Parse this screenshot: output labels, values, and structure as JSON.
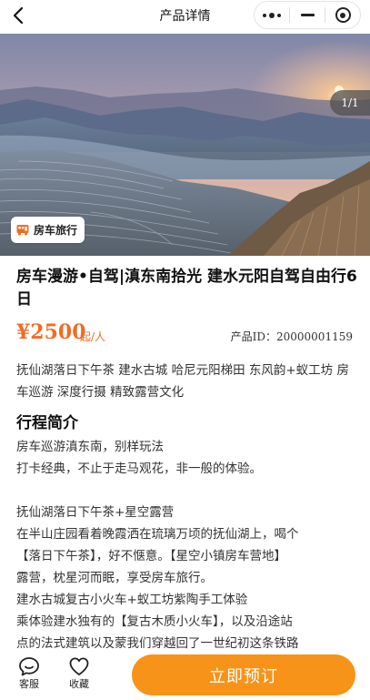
{
  "navbar": {
    "title": "产品详情",
    "back_icon": "chevron-left-icon",
    "capsule_icons": [
      "more-dots-icon",
      "minimize-icon",
      "target-icon"
    ]
  },
  "hero": {
    "counter": "1/1",
    "tag_label": "房车旅行",
    "tag_icon": "rv-travel-icon"
  },
  "product": {
    "title": "房车漫游•自驾|滇东南拾光 建水元阳自驾自由行6日",
    "price": "¥2500",
    "price_suffix": "起/人",
    "product_id": "产品ID：20000001159",
    "features": "抚仙湖落日下午茶 建水古城 哈尼元阳梯田 东风韵+蚁工坊 房车巡游 深度行摄 精致露营文化"
  },
  "itinerary": {
    "section_title": "行程简介",
    "lines": [
      "房车巡游滇东南，别样玩法",
      "打卡经典，不止于走马观花，非一般的体验。",
      "",
      "抚仙湖落日下午茶+星空露营",
      "在半山庄园看着晚霞洒在琉璃万顷的抚仙湖上，喝个",
      "【落日下午茶】，好不惬意。【星空小镇房车营地】",
      "露营，枕星河而眠，享受房车旅行。",
      "建水古城复古小火车+蚁工坊紫陶手工体验",
      "乘体验建水独有的【复古木质小火车】，以及沿途站",
      "点的法式建筑以及蒙我们穿越回了一世纪初这条铁路"
    ]
  },
  "bottom_bar": {
    "service_label": "客服",
    "favorite_label": "收藏",
    "book_label": "立即预订"
  },
  "colors": {
    "accent_orange": "#f26b22",
    "button_orange": "#f79318"
  }
}
